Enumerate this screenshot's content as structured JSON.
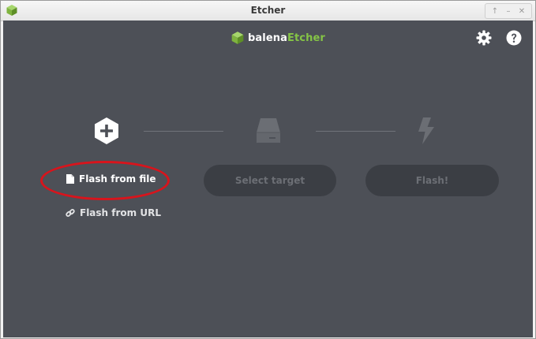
{
  "window": {
    "title": "Etcher",
    "icon": "balena-cube-icon",
    "controls": [
      {
        "name": "maximize-button",
        "glyph": "↑"
      },
      {
        "name": "minimize-button",
        "glyph": "–"
      },
      {
        "name": "close-button",
        "glyph": "✕"
      }
    ]
  },
  "header": {
    "logo_prefix": "balena",
    "logo_accent": "Etcher",
    "settings_icon": "gear-icon",
    "help_icon": "help-icon"
  },
  "steps": {
    "source": {
      "icon": "plus-hexagon-icon",
      "flash_from_file_label": "Flash from file",
      "flash_from_url_label": "Flash from URL"
    },
    "target": {
      "icon": "drive-icon",
      "button_label": "Select target"
    },
    "flash": {
      "icon": "lightning-icon",
      "button_label": "Flash!"
    }
  },
  "colors": {
    "background": "#4d5057",
    "accent": "#85c446",
    "disabled_button": "#3b3e44",
    "disabled_text": "#6c6f75",
    "annotation": "#d8141c"
  }
}
